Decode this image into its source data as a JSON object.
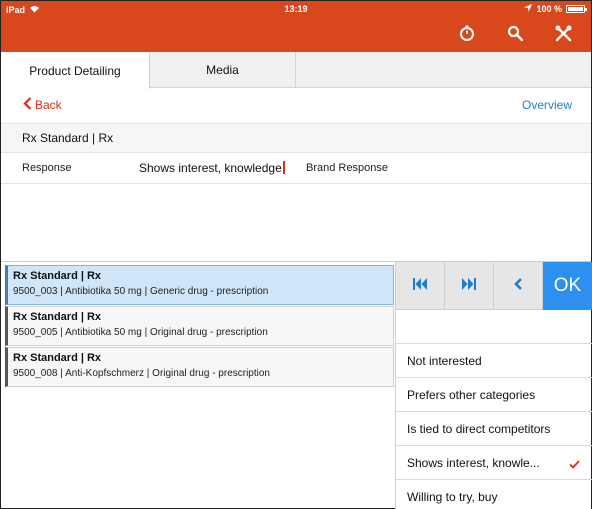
{
  "status_bar": {
    "device": "iPad",
    "time": "13:19",
    "battery": "100 %"
  },
  "tabs": [
    {
      "label": "Product Detailing"
    },
    {
      "label": "Media"
    }
  ],
  "nav": {
    "back": "Back",
    "overview": "Overview"
  },
  "section": {
    "title": "Rx Standard | Rx"
  },
  "response": {
    "label": "Response",
    "value": "Shows interest, knowledge",
    "brand_label": "Brand Response"
  },
  "products": [
    {
      "title": "Rx Standard | Rx",
      "subtitle": "9500_003 | Antibiotika 50 mg | Generic drug - prescription",
      "selected": true
    },
    {
      "title": "Rx Standard | Rx",
      "subtitle": "9500_005 | Antibiotika 50 mg | Original drug - prescription",
      "selected": false
    },
    {
      "title": "Rx Standard | Rx",
      "subtitle": "9500_008 | Anti-Kopfschmerz | Original drug - prescription",
      "selected": false
    }
  ],
  "picker": {
    "ok_label": "OK",
    "options": [
      {
        "label": ""
      },
      {
        "label": "Not interested"
      },
      {
        "label": "Prefers other categories"
      },
      {
        "label": "Is tied to direct competitors"
      },
      {
        "label": "Shows interest, knowle...",
        "checked": true
      },
      {
        "label": "Willing to try, buy"
      }
    ]
  },
  "colors": {
    "header": "#d9481d",
    "accent": "#e02a12",
    "link": "#1a7fd4",
    "ok": "#2d8ff0",
    "selected": "#cfe6f8"
  },
  "icons": [
    "wifi-icon",
    "location-icon",
    "battery-icon",
    "stopwatch-icon",
    "search-icon",
    "tools-icon",
    "back-chevron-icon",
    "skip-first-icon",
    "skip-last-icon",
    "prev-icon",
    "checkmark-icon"
  ]
}
